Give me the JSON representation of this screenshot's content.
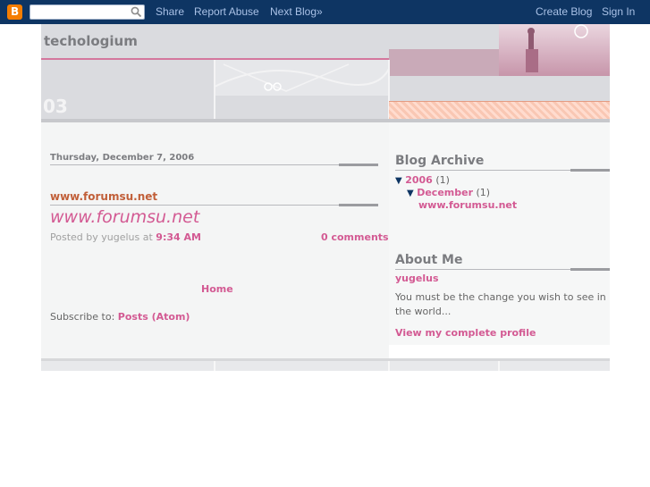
{
  "navbar": {
    "logo_icon": "blogger-logo-icon",
    "search_value": "",
    "search_icon": "search-icon",
    "links": {
      "share": "Share",
      "report_abuse": "Report Abuse",
      "next_blog": "Next Blog»",
      "create_blog": "Create Blog",
      "sign_in": "Sign In"
    }
  },
  "header": {
    "title": "techologium",
    "badge": "03"
  },
  "post": {
    "date": "Thursday, December 7, 2006",
    "link_title": "www.forumsu.net",
    "body_title": "www.forumsu.net",
    "posted_by_prefix": "Posted by yugelus at",
    "time": "9:34 AM",
    "comments": "0 comments"
  },
  "main_footer": {
    "home": "Home",
    "subscribe_prefix": "Subscribe to:",
    "subscribe_link": "Posts (Atom)"
  },
  "sidebar": {
    "archive": {
      "heading": "Blog Archive",
      "year": "2006",
      "year_count": "(1)",
      "month": "December",
      "month_count": "(1)",
      "post": "www.forumsu.net"
    },
    "about": {
      "heading": "About Me",
      "name": "yugelus",
      "text": "You must be the change you wish to see in the world...",
      "profile_link": "View my complete profile"
    }
  },
  "colors": {
    "navbar": "#0e3563",
    "link_pink": "#d35a93",
    "title_orange": "#c15f39"
  }
}
